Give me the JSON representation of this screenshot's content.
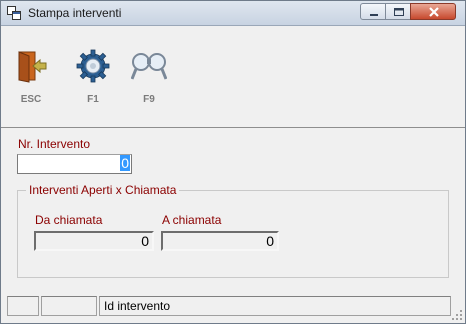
{
  "window": {
    "title": "Stampa interventi"
  },
  "toolbar": {
    "buttons": [
      {
        "label": "ESC",
        "icon": "exit-door-icon"
      },
      {
        "label": "F1",
        "icon": "gear-icon"
      },
      {
        "label": "F9",
        "icon": "binoculars-icon"
      }
    ]
  },
  "form": {
    "nr_intervento": {
      "label": "Nr. Intervento",
      "value": "0"
    },
    "group": {
      "title": "Interventi Aperti x Chiamata",
      "da": {
        "label": "Da chiamata",
        "value": "0"
      },
      "a": {
        "label": "A chiamata",
        "value": "0"
      }
    }
  },
  "statusbar": {
    "panes": [
      "",
      "",
      "Id intervento"
    ]
  }
}
